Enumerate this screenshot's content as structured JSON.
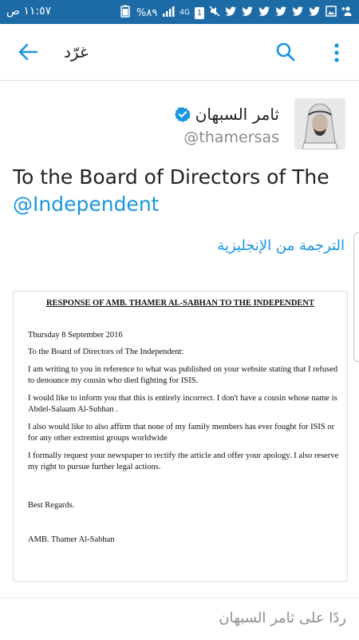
{
  "status_bar": {
    "time": "١١:٥٧ ص",
    "battery": "%٨٩",
    "network": "4G",
    "sim": "1",
    "icons": [
      "battery-icon",
      "signal-icon",
      "network-icon",
      "sim-icon",
      "mute-icon",
      "twitter-icon",
      "twitter-icon",
      "twitter-icon",
      "twitter-icon",
      "twitter-icon",
      "twitter-icon",
      "image-icon",
      "add-user-icon"
    ]
  },
  "app_bar": {
    "title": "غرّد"
  },
  "tweet": {
    "display_name": "ثامر السبهان",
    "handle": "@thamersas",
    "text_before": "To the Board of Directors of The ",
    "mention": "@Independent",
    "translate_label": "الترجمة من الإنجليزية"
  },
  "document": {
    "title": "RESPONSE OF AMB. THAMER AL-SABHAN TO THE INDEPENDENT",
    "date": "Thursday 8 September 2016",
    "salutation": "To the Board of Directors of The Independent:",
    "p1": "I am writing to you in reference to what was published on your website stating that I refused to denounce my cousin who died fighting for ISIS.",
    "p2": " I would like to inform you that this is entirely incorrect. I don't have a cousin whose name is Abdel-Salaam Al-Subhan .",
    "p3": " I also would like to also affirm that none of my family members has ever fought for ISIS or for any other extremist groups worldwide",
    "p4": "I formally request your newspaper to rectify the article and offer your apology. I also reserve my right to pursue further legal actions.",
    "closing": "Best Regards.",
    "signature": "AMB. Thamer Al-Sabhan"
  },
  "reply": {
    "placeholder": "ردًا على ثامر السبهان"
  },
  "colors": {
    "status_bar": "#1c6aa6",
    "accent": "#1b95e0",
    "text": "#222222",
    "muted": "#8a8a8a"
  }
}
